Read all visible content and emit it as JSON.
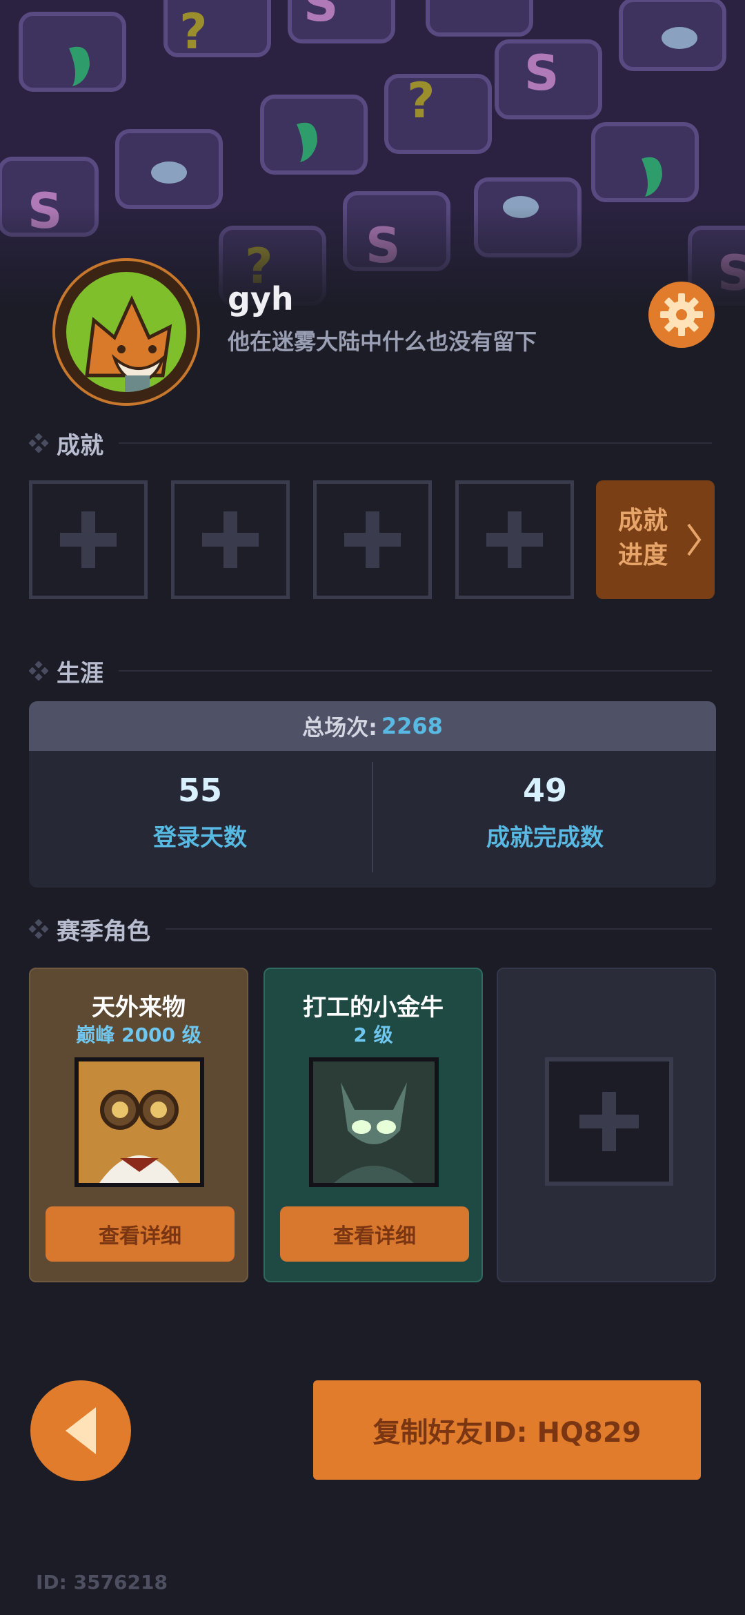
{
  "profile": {
    "username": "gyh",
    "bio": "他在迷雾大陆中什么也没有留下"
  },
  "sections": {
    "achievements": "成就",
    "career": "生涯",
    "season_characters": "赛季角色"
  },
  "achievements": {
    "progress_label_line1": "成就",
    "progress_label_line2": "进度"
  },
  "career": {
    "total_label": "总场次:",
    "total_value": "2268",
    "stats": [
      {
        "value": "55",
        "label": "登录天数"
      },
      {
        "value": "49",
        "label": "成就完成数"
      }
    ]
  },
  "characters": [
    {
      "name": "天外来物",
      "level": "巅峰 2000 级",
      "button": "查看详细"
    },
    {
      "name": "打工的小金牛",
      "level": "2 级",
      "button": "查看详细"
    }
  ],
  "footer": {
    "copy_friend_id": "复制好友ID: HQ829",
    "user_id": "ID: 3576218"
  },
  "colors": {
    "accent_orange": "#e07c2c",
    "stat_blue": "#58b9e3",
    "background": "#1b1c26"
  }
}
